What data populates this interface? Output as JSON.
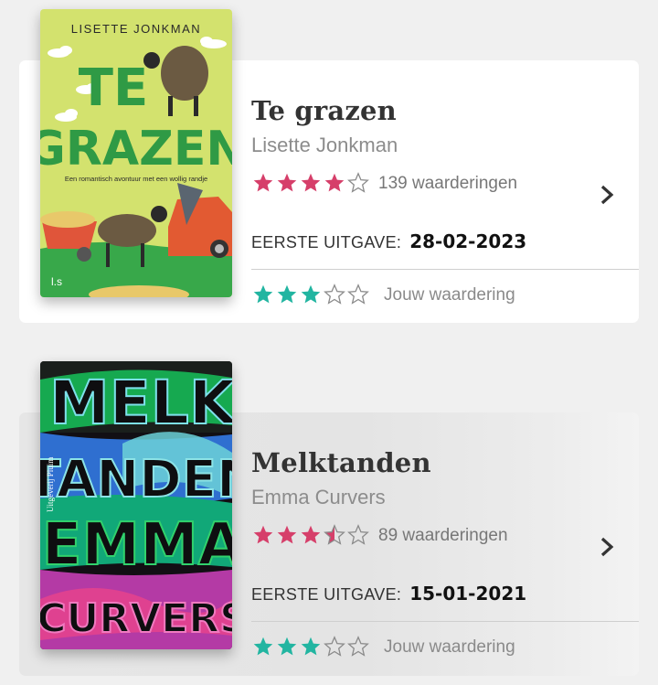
{
  "books": [
    {
      "cover": {
        "author": "LISETTE JONKMAN",
        "title_lines": [
          "TE",
          "GRAZEN"
        ],
        "subtitle": "Een romantisch avontuur met een wollig randje",
        "publisher_mark": "l.s"
      },
      "title": "Te grazen",
      "author": "Lisette Jonkman",
      "avg_rating": 4,
      "avg_rating_max": 5,
      "ratings_count": "139 waarderingen",
      "first_release_label": "EERSTE UITGAVE:",
      "first_release_date": "28-02-2023",
      "my_rating": 3,
      "my_rating_label": "Jouw waardering",
      "chevron_icon": "chevron-right-icon"
    },
    {
      "cover": {
        "publisher_mark": "Uitgeverij Pluim",
        "lines": [
          "MELK",
          "TANDEN",
          "EMMA",
          "CURVERS"
        ]
      },
      "title": "Melktanden",
      "author": "Emma Curvers",
      "avg_rating": 3.5,
      "avg_rating_max": 5,
      "ratings_count": "89 waarderingen",
      "first_release_label": "EERSTE UITGAVE:",
      "first_release_date": "15-01-2021",
      "my_rating": 3,
      "my_rating_label": "Jouw waardering",
      "chevron_icon": "chevron-right-icon"
    }
  ],
  "colors": {
    "avg_star": "#d63f6a",
    "my_star": "#22b5a1",
    "empty_star": "#8a8a8a",
    "card_bg": "#ffffff",
    "page_bg": "#f0f0f0"
  }
}
